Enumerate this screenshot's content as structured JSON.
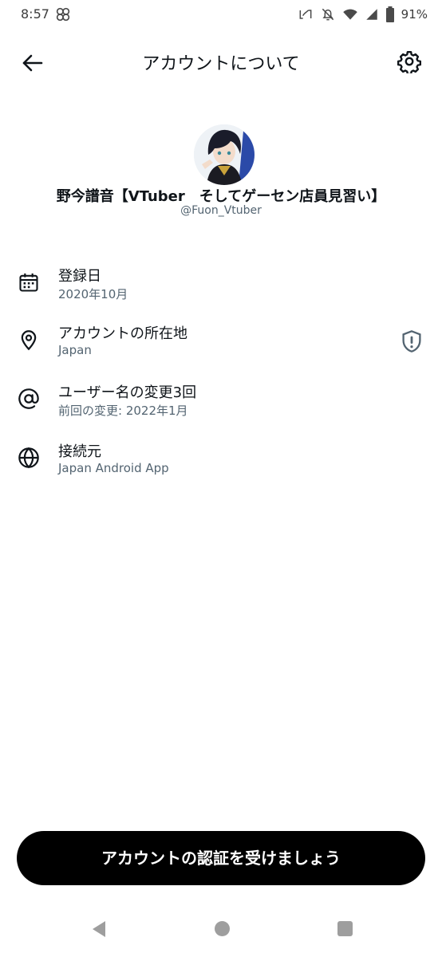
{
  "status_bar": {
    "time": "8:57",
    "battery": "91%",
    "icons": [
      "pinwheel-icon",
      "nfc-icon",
      "bell-off-icon",
      "wifi-icon",
      "signal-icon",
      "battery-icon"
    ]
  },
  "header": {
    "title": "アカウントについて",
    "back_icon": "arrow-left-icon",
    "settings_icon": "gear-icon"
  },
  "profile": {
    "display_name": "野今譜音【VTuber　そしてゲーセン店員見習い】",
    "handle": "@Fuon_Vtuber"
  },
  "info_items": [
    {
      "icon": "calendar-icon",
      "label": "登録日",
      "value": "2020年10月"
    },
    {
      "icon": "location-pin-icon",
      "label": "アカウントの所在地",
      "value": "Japan",
      "trailing_icon": "shield-alert-icon"
    },
    {
      "icon": "at-sign-icon",
      "label": "ユーザー名の変更3回",
      "value": "前回の変更: 2022年1月"
    },
    {
      "icon": "globe-icon",
      "label": "接続元",
      "value": "Japan Android App"
    }
  ],
  "cta": {
    "label": "アカウントの認証を受けましょう"
  },
  "colors": {
    "primary_text": "#0f1419",
    "secondary_text": "#536471",
    "button_bg": "#000000",
    "button_text": "#ffffff"
  }
}
